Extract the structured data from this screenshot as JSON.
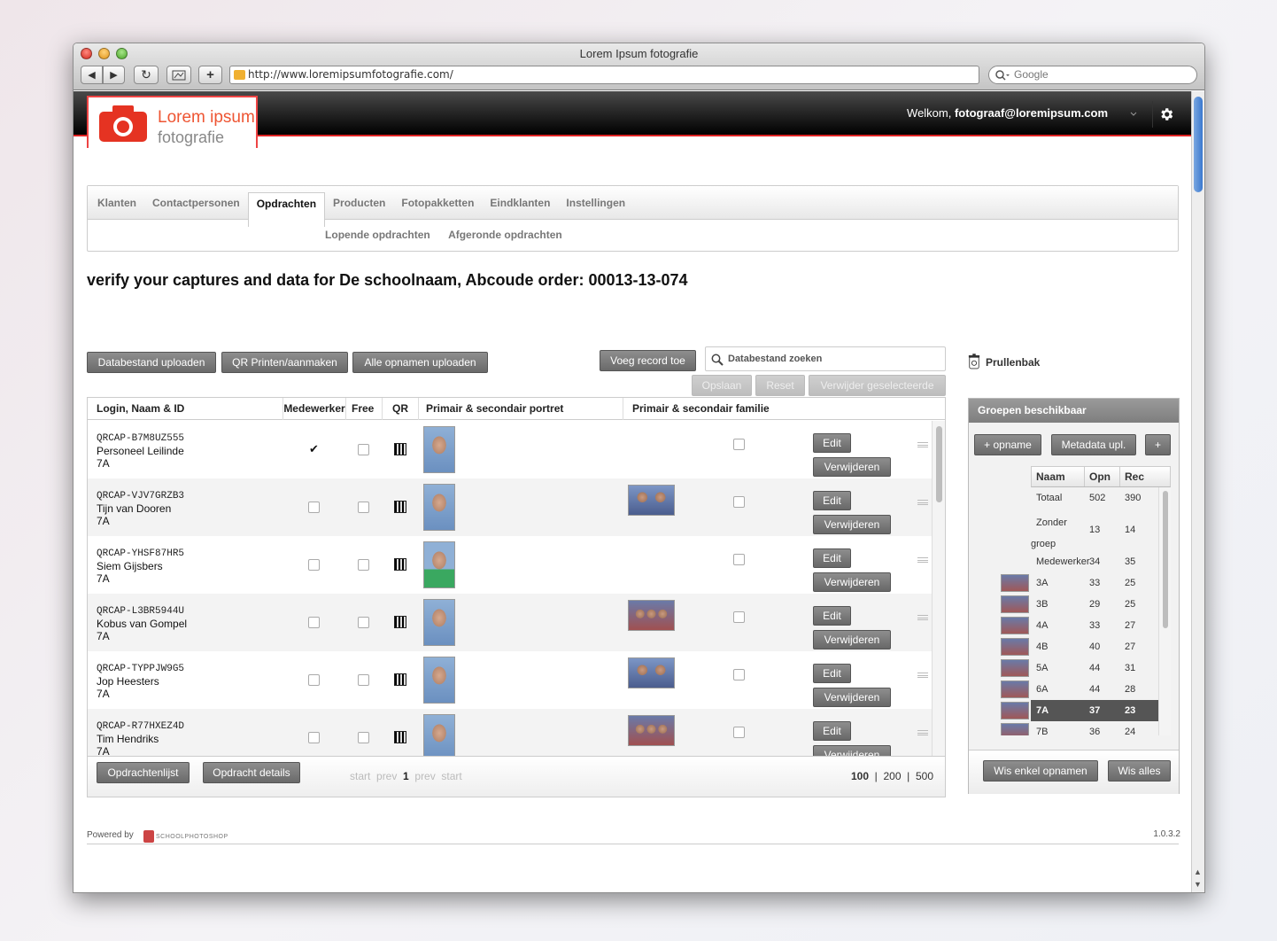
{
  "browser": {
    "title": "Lorem Ipsum fotografie",
    "url": "http://www.loremipsumfotografie.com/",
    "search_placeholder": "Google",
    "back": "◀",
    "forward": "▶",
    "reload": "↻",
    "add_tab": "+",
    "scroll_up": "▲",
    "scroll_down": "▼"
  },
  "header": {
    "logo_line1": "Lorem ipsum",
    "logo_line2": "fotografie",
    "welcome_prefix": "Welkom, ",
    "user_email": "fotograaf@loremipsum.com",
    "dropdown_icon": "chevron-down-icon",
    "settings_icon": "gear-icon"
  },
  "nav": {
    "tabs": [
      "Klanten",
      "Contactpersonen",
      "Opdrachten",
      "Producten",
      "Fotopakketten",
      "Eindklanten",
      "Instellingen"
    ],
    "active_tab": "Opdrachten",
    "subtabs": [
      "Lopende opdrachten",
      "Afgeronde opdrachten"
    ]
  },
  "page": {
    "title": "verify your captures and data for De schoolnaam, Abcoude  order: 00013-13-074"
  },
  "actions": {
    "upload_db": "Databestand uploaden",
    "qr_print": "QR Printen/aanmaken",
    "upload_all": "Alle opnamen uploaden",
    "add_record": "Voeg record toe",
    "search_placeholder": "Databestand zoeken",
    "save": "Opslaan",
    "reset": "Reset",
    "delete_selected": "Verwijder geselecteerde",
    "trash": "Prullenbak"
  },
  "table": {
    "columns": [
      "Login, Naam & ID",
      "Medewerker",
      "Free",
      "QR",
      "Primair & secondair portret",
      "Primair & secondair familie"
    ],
    "edit_label": "Edit",
    "delete_label": "Verwijderen",
    "rows": [
      {
        "id": "QRCAP-B7M8UZ555",
        "name": "Personeel Leilinde",
        "group": "7A",
        "medewerker": true,
        "free": false,
        "family": false,
        "family_checked": false
      },
      {
        "id": "QRCAP-VJV7GRZB3",
        "name": "Tijn van Dooren",
        "group": "7A",
        "medewerker": false,
        "free": false,
        "family": true,
        "family_checked": false
      },
      {
        "id": "QRCAP-YHSF87HR5",
        "name": "Siem Gijsbers",
        "group": "7A",
        "medewerker": false,
        "free": false,
        "family": false,
        "family_checked": false
      },
      {
        "id": "QRCAP-L3BR5944U",
        "name": "Kobus van Gompel",
        "group": "7A",
        "medewerker": false,
        "free": false,
        "family": true,
        "family_checked": false
      },
      {
        "id": "QRCAP-TYPPJW9G5",
        "name": "Jop Heesters",
        "group": "7A",
        "medewerker": false,
        "free": false,
        "family": true,
        "family_checked": false
      },
      {
        "id": "QRCAP-R77HXEZ4D",
        "name": "Tim Hendriks",
        "group": "7A",
        "medewerker": false,
        "free": false,
        "family": true,
        "family_checked": false
      }
    ]
  },
  "footer": {
    "orders_list": "Opdrachtenlijst",
    "order_details": "Opdracht details",
    "pager": {
      "start": "start",
      "prev": "prev",
      "current": "1",
      "prev2": "prev",
      "start2": "start"
    },
    "per_page": [
      "100",
      "200",
      "500"
    ],
    "per_page_active": "100",
    "separator": "|"
  },
  "groups": {
    "title": "Groepen beschikbaar",
    "add_capture": "+ opname",
    "metadata_upload": "Metadata upl.",
    "add": "+",
    "columns": [
      "Naam",
      "Opn",
      "Rec"
    ],
    "rows": [
      {
        "name": "Totaal",
        "opn": "502",
        "rec": "390",
        "thumb": false
      },
      {
        "name": "Zonder groep",
        "opn": "13",
        "rec": "14",
        "thumb": false
      },
      {
        "name": "Medewerker",
        "opn": "34",
        "rec": "35",
        "thumb": false
      },
      {
        "name": "3A",
        "opn": "33",
        "rec": "25",
        "thumb": true
      },
      {
        "name": "3B",
        "opn": "29",
        "rec": "25",
        "thumb": true
      },
      {
        "name": "4A",
        "opn": "33",
        "rec": "27",
        "thumb": true
      },
      {
        "name": "4B",
        "opn": "40",
        "rec": "27",
        "thumb": true
      },
      {
        "name": "5A",
        "opn": "44",
        "rec": "31",
        "thumb": true
      },
      {
        "name": "6A",
        "opn": "44",
        "rec": "28",
        "thumb": true
      },
      {
        "name": "7A",
        "opn": "37",
        "rec": "23",
        "thumb": true,
        "selected": true
      },
      {
        "name": "7B",
        "opn": "36",
        "rec": "24",
        "thumb": true
      }
    ],
    "clear_captures": "Wis enkel opnamen",
    "clear_all": "Wis alles"
  },
  "site_footer": {
    "powered_by": "Powered by",
    "brand": "SCHOOLPHOTOSHOP",
    "version": "1.0.3.2"
  },
  "colors": {
    "brand_red": "#e53322",
    "header_black": "#000000",
    "button_gray": "#7a7a7a",
    "selected_row": "#555555"
  }
}
